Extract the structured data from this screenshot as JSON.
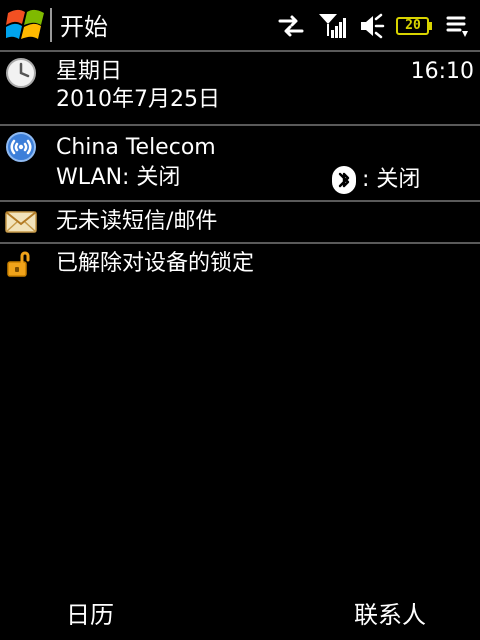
{
  "titlebar": {
    "title": "开始",
    "battery_label": "20"
  },
  "rows": {
    "datetime": {
      "day": "星期日",
      "date": "2010年7月25日",
      "time": "16:10"
    },
    "network": {
      "carrier": "China Telecom",
      "wlan_status": "WLAN: 关闭",
      "bluetooth_status": ": 关闭"
    },
    "messages": {
      "label": "无未读短信/邮件"
    },
    "lock": {
      "label": "已解除对设备的锁定"
    }
  },
  "softkeys": {
    "left_label": "日历",
    "right_label": "联系人"
  },
  "icons": {
    "start": "windows-logo",
    "sync": "sync-arrows-icon",
    "signal": "signal-icon",
    "volume": "speaker-icon",
    "battery": "battery-icon",
    "menu": "menu-icon",
    "clock": "clock-icon",
    "wireless": "wireless-icon",
    "bluetooth": "bluetooth-icon",
    "mail": "mail-icon",
    "unlock": "unlock-icon"
  },
  "colors": {
    "background": "#000000",
    "text": "#ffffff",
    "battery_accent": "#d9d400",
    "divider": "#5a5a5a"
  }
}
